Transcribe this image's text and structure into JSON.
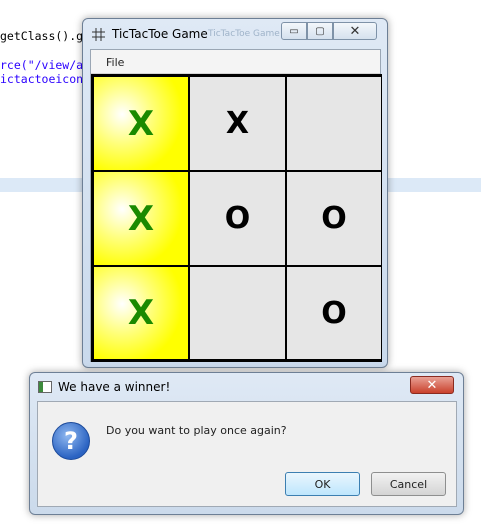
{
  "editor": {
    "lines": [
      {
        "code": "getClass().ge"
      },
      {
        "code": "rce(\"/view/ap"
      },
      {
        "code": "ictactoeicon"
      }
    ]
  },
  "game_window": {
    "title": "TicTacToe Game",
    "ghost_title": "TicTacToe Game",
    "menu": {
      "file": "File"
    },
    "board": [
      [
        {
          "mark": "X",
          "winning": true
        },
        {
          "mark": "X",
          "winning": false
        },
        {
          "mark": "",
          "winning": false
        }
      ],
      [
        {
          "mark": "X",
          "winning": true
        },
        {
          "mark": "O",
          "winning": false
        },
        {
          "mark": "O",
          "winning": false
        }
      ],
      [
        {
          "mark": "X",
          "winning": true
        },
        {
          "mark": "",
          "winning": false
        },
        {
          "mark": "O",
          "winning": false
        }
      ]
    ],
    "controls": {
      "minimize": "▭",
      "maximize": "▢",
      "close": "✕"
    }
  },
  "dialog": {
    "title": "We have a winner!",
    "message": "Do you want to play once again?",
    "icon": "question-icon",
    "ok_label": "OK",
    "cancel_label": "Cancel",
    "close_glyph": "✕"
  },
  "colors": {
    "winning_cell": "#ffff00",
    "winning_mark": "#1a8a00",
    "cell": "#e6e6e6"
  }
}
